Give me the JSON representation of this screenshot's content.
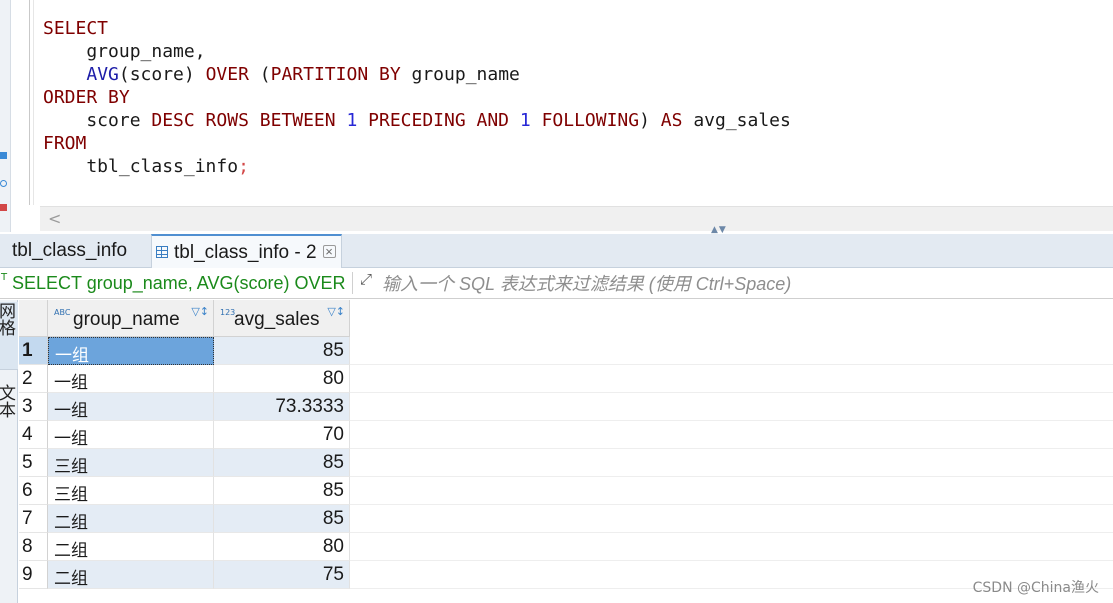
{
  "editor": {
    "lines": [
      {
        "segments": [
          {
            "t": "SELECT",
            "c": "kw"
          }
        ]
      },
      {
        "segments": [
          {
            "t": "    group_name,",
            "c": ""
          }
        ]
      },
      {
        "segments": [
          {
            "t": "    ",
            "c": ""
          },
          {
            "t": "AVG",
            "c": "fn"
          },
          {
            "t": "(score) ",
            "c": ""
          },
          {
            "t": "OVER",
            "c": "kw"
          },
          {
            "t": " (",
            "c": ""
          },
          {
            "t": "PARTITION BY",
            "c": "kw"
          },
          {
            "t": " group_name",
            "c": ""
          }
        ]
      },
      {
        "segments": [
          {
            "t": "ORDER BY",
            "c": "kw"
          }
        ]
      },
      {
        "segments": [
          {
            "t": "    score ",
            "c": ""
          },
          {
            "t": "DESC ROWS BETWEEN",
            "c": "kw"
          },
          {
            "t": " ",
            "c": ""
          },
          {
            "t": "1",
            "c": "num"
          },
          {
            "t": " ",
            "c": ""
          },
          {
            "t": "PRECEDING AND",
            "c": "kw"
          },
          {
            "t": " ",
            "c": ""
          },
          {
            "t": "1",
            "c": "num"
          },
          {
            "t": " ",
            "c": ""
          },
          {
            "t": "FOLLOWING",
            "c": "kw"
          },
          {
            "t": ") ",
            "c": ""
          },
          {
            "t": "AS",
            "c": "kw"
          },
          {
            "t": " avg_sales",
            "c": ""
          }
        ]
      },
      {
        "segments": [
          {
            "t": "FROM",
            "c": "kw"
          }
        ]
      },
      {
        "segments": [
          {
            "t": "    tbl_class_info",
            "c": ""
          },
          {
            "t": ";",
            "c": "semi"
          }
        ]
      }
    ],
    "scroll_left_glyph": "<",
    "split_glyph": "▲▼"
  },
  "tabs": [
    {
      "label": "tbl_class_info",
      "active": false
    },
    {
      "label": "tbl_class_info - 2",
      "active": true,
      "close": "×"
    }
  ],
  "filter": {
    "query": "SELECT group_name, AVG(score) OVER (PARTITION BY group_name",
    "query_icon": "T",
    "filter_icon": "⤢",
    "placeholder": "输入一个 SQL 表达式来过滤结果 (使用 Ctrl+Space)"
  },
  "side_tabs": {
    "grid": "网格",
    "text": "文本"
  },
  "grid": {
    "columns": [
      {
        "name": "group_name",
        "type_badge": "ABC",
        "tools": "▽↕"
      },
      {
        "name": "avg_sales",
        "type_badge": "123",
        "tools": "▽↕"
      }
    ],
    "rows": [
      {
        "num": "1",
        "group_name": "一组",
        "avg_sales": "85",
        "selected": true
      },
      {
        "num": "2",
        "group_name": "一组",
        "avg_sales": "80"
      },
      {
        "num": "3",
        "group_name": "一组",
        "avg_sales": "73.3333"
      },
      {
        "num": "4",
        "group_name": "一组",
        "avg_sales": "70"
      },
      {
        "num": "5",
        "group_name": "三组",
        "avg_sales": "85"
      },
      {
        "num": "6",
        "group_name": "三组",
        "avg_sales": "85"
      },
      {
        "num": "7",
        "group_name": "二组",
        "avg_sales": "85"
      },
      {
        "num": "8",
        "group_name": "二组",
        "avg_sales": "80"
      },
      {
        "num": "9",
        "group_name": "二组",
        "avg_sales": "75"
      }
    ]
  },
  "watermark": "CSDN @China渔火",
  "colors": {
    "keyword": "#7f0000",
    "function": "#1d1da8",
    "number": "#2727d6",
    "query_green": "#1b8a1b",
    "row_shade": "#e4ecf5",
    "selection": "#6ca4dc"
  }
}
